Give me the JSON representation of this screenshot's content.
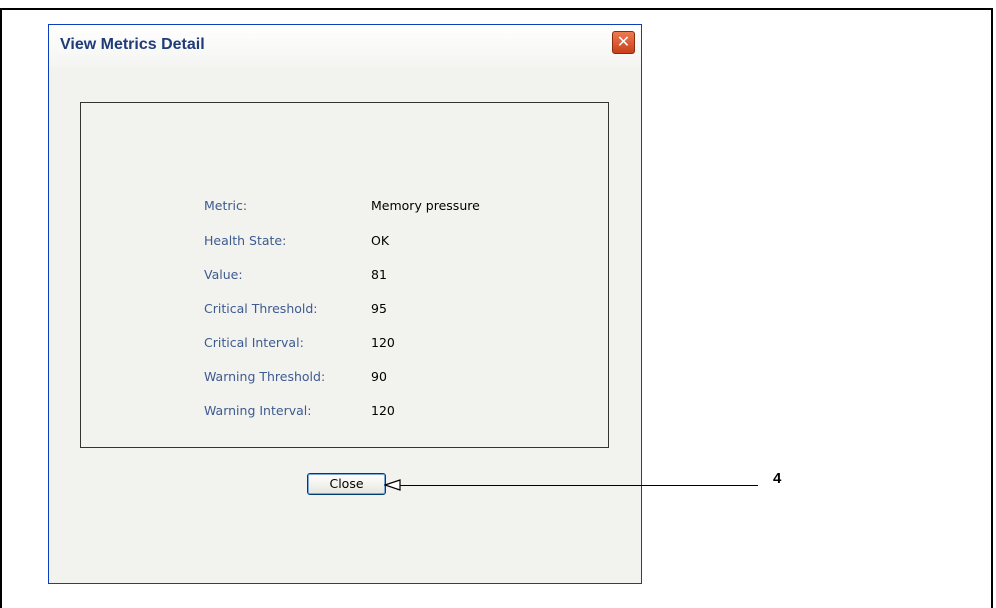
{
  "dialog": {
    "title": "View Metrics Detail",
    "close_icon": "close-x-icon",
    "close_button_label": "Close"
  },
  "metrics": [
    {
      "label": "Metric:",
      "value": "Memory pressure"
    },
    {
      "label": "Health State:",
      "value": "OK"
    },
    {
      "label": "Value:",
      "value": "81"
    },
    {
      "label": "Critical Threshold:",
      "value": "95"
    },
    {
      "label": "Critical Interval:",
      "value": "120"
    },
    {
      "label": "Warning Threshold:",
      "value": "90"
    },
    {
      "label": "Warning Interval:",
      "value": "120"
    }
  ],
  "callout": {
    "number": "4"
  },
  "colors": {
    "title_text": "#1f3b78",
    "label_text": "#3d5b8f",
    "window_border": "#0a3fbf",
    "close_x": "#d9522b"
  }
}
